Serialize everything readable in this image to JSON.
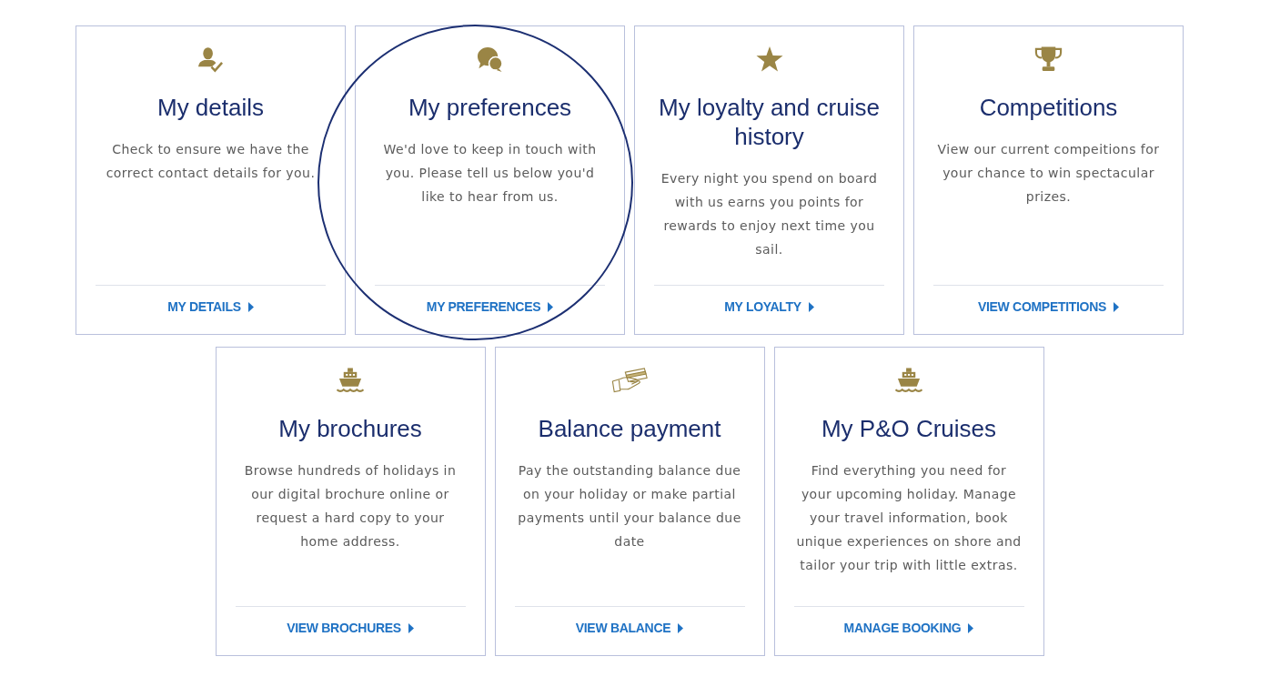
{
  "rows": [
    {
      "cards": [
        {
          "kind": "details",
          "title": "My details",
          "description": "Check to ensure we have the correct contact details for you.",
          "link": "MY DETAILS",
          "highlighted": false
        },
        {
          "kind": "preferences",
          "title": "My preferences",
          "description": "We'd love to keep in touch with you. Please tell us below you'd like to hear from us.",
          "link": "MY PREFERENCES",
          "highlighted": true
        },
        {
          "kind": "loyalty",
          "title": "My loyalty and cruise history",
          "description": "Every night you spend on board with us earns you points for rewards to enjoy next time you sail.",
          "link": "MY LOYALTY",
          "highlighted": false
        },
        {
          "kind": "competitions",
          "title": "Competitions",
          "description": "View our current compeitions for your chance to win spectacular prizes.",
          "link": "VIEW COMPETITIONS",
          "highlighted": false
        }
      ]
    },
    {
      "cards": [
        {
          "kind": "brochures",
          "title": "My brochures",
          "description": "Browse hundreds of holidays in our digital brochure online or request a hard copy to your home address.",
          "link": "VIEW BROCHURES",
          "highlighted": false
        },
        {
          "kind": "payment",
          "title": "Balance payment",
          "description": "Pay the outstanding balance due on your holiday or make partial payments until your balance due date",
          "link": "VIEW BALANCE",
          "highlighted": false
        },
        {
          "kind": "booking",
          "title": "My P&O Cruises",
          "description": "Find everything you need for your upcoming holiday. Manage your travel information, book unique experiences on shore and tailor your trip with little extras.",
          "link": "MANAGE BOOKING",
          "highlighted": false
        }
      ]
    }
  ]
}
